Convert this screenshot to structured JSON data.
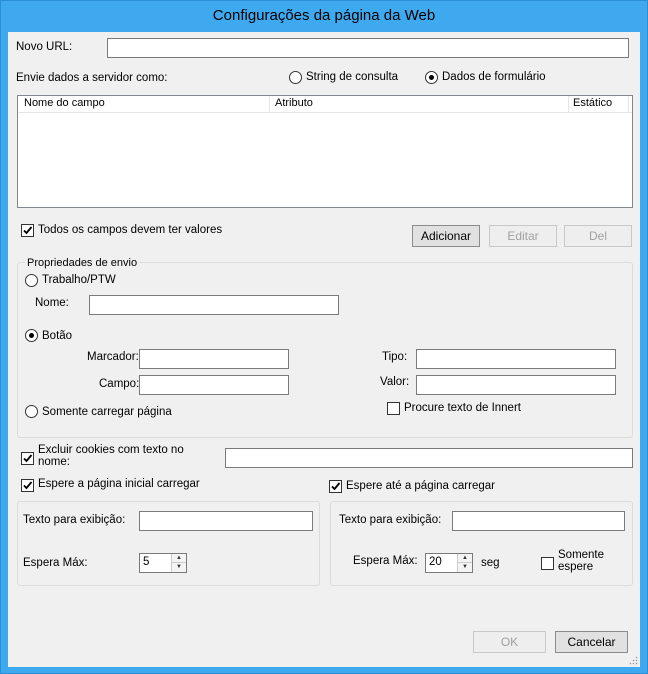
{
  "window": {
    "title": "Configurações da página da Web"
  },
  "url": {
    "label": "Novo URL:",
    "value": ""
  },
  "send": {
    "label": "Envie dados a servidor como:",
    "option_query": "String de consulta",
    "option_form": "Dados de formulário",
    "selected": "form"
  },
  "fields_table": {
    "columns": [
      "Nome do campo",
      "Atributo",
      "Estático"
    ],
    "rows": []
  },
  "all_fields_required": {
    "label": "Todos os campos devem ter valores",
    "checked": true
  },
  "buttons": {
    "add": "Adicionar",
    "edit": "Editar",
    "del": "Del",
    "ok": "OK",
    "cancel": "Cancelar"
  },
  "submit": {
    "group_label": "Propriedades de envio",
    "option_job": "Trabalho/PTW",
    "name_label": "Nome:",
    "name_value": "",
    "option_button": "Botão",
    "selected": "button",
    "marker_label": "Marcador:",
    "field_label": "Campo:",
    "type_label": "Tipo:",
    "value_label": "Valor:",
    "option_load_only": "Somente carregar página",
    "innertext_label": "Procure texto de Innert",
    "innertext_checked": false
  },
  "exclude_cookies": {
    "label_line1": "Excluir cookies com texto no",
    "label_line2": "nome:",
    "checked": true,
    "value": ""
  },
  "wait_initial": {
    "label": "Espere a página inicial carregar",
    "checked": true,
    "display_label": "Texto para exibição:",
    "max_label": "Espera Máx:",
    "max_value": "5"
  },
  "wait_until": {
    "label": "Espere até a página carregar",
    "checked": true,
    "display_label": "Texto para exibição:",
    "max_label": "Espera Máx:",
    "max_value": "20",
    "unit": "seg",
    "only_wait_line1": "Somente",
    "only_wait_line2": "espere",
    "only_wait_checked": false
  }
}
